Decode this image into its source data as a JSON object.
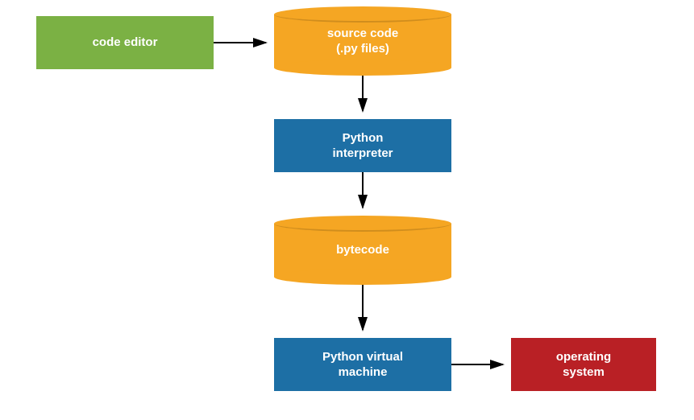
{
  "nodes": {
    "code_editor": {
      "label": "code editor"
    },
    "source_code": {
      "label_line1": "source code",
      "label_line2": "(.py files)"
    },
    "python_interpreter": {
      "label_line1": "Python",
      "label_line2": "interpreter"
    },
    "bytecode": {
      "label": "bytecode"
    },
    "python_vm": {
      "label_line1": "Python virtual",
      "label_line2": "machine"
    },
    "operating_system": {
      "label_line1": "operating",
      "label_line2": "system"
    }
  },
  "edges": [
    {
      "from": "code_editor",
      "to": "source_code"
    },
    {
      "from": "source_code",
      "to": "python_interpreter"
    },
    {
      "from": "python_interpreter",
      "to": "bytecode"
    },
    {
      "from": "bytecode",
      "to": "python_vm"
    },
    {
      "from": "python_vm",
      "to": "operating_system"
    }
  ],
  "colors": {
    "green": "#7BB144",
    "blue": "#1D6FA5",
    "orange": "#F5A623",
    "red": "#B92025",
    "arrow": "#000000"
  }
}
